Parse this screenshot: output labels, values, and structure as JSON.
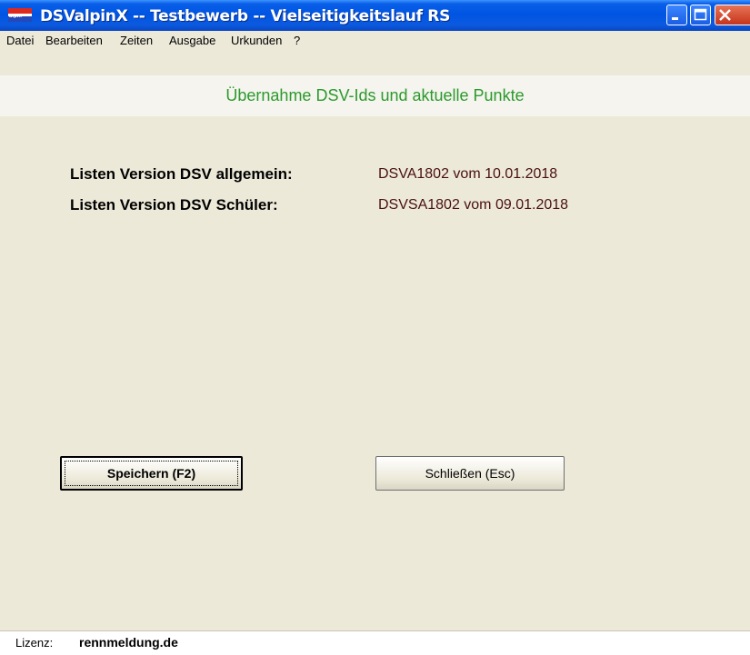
{
  "window": {
    "title": "DSValpinX -- Testbewerb -- Vielseitigkeitslauf RS",
    "icon_text": "alpin"
  },
  "menu": {
    "items": [
      "Datei",
      "Bearbeiten",
      "Zeiten",
      "Ausgabe",
      "Urkunden",
      "?"
    ]
  },
  "page": {
    "title": "Übernahme DSV-Ids und aktuelle Punkte"
  },
  "info": {
    "rows": [
      {
        "label": "Listen Version DSV allgemein:",
        "value": "DSVA1802 vom 10.01.2018"
      },
      {
        "label": "Listen Version DSV Schüler:",
        "value": "DSVSA1802 vom 09.01.2018"
      }
    ]
  },
  "buttons": {
    "save_label": "Speichern (F2)",
    "close_label": "Schließen (Esc)"
  },
  "status": {
    "label": "Lizenz:",
    "value": "rennmeldung.de"
  },
  "colors": {
    "title_bar": "#0054e3",
    "window_bg": "#ece9d8",
    "page_title": "#2c9a2c",
    "value_text": "#4a1010"
  },
  "icons": [
    "app-icon",
    "minimize-icon",
    "maximize-icon",
    "close-icon"
  ]
}
